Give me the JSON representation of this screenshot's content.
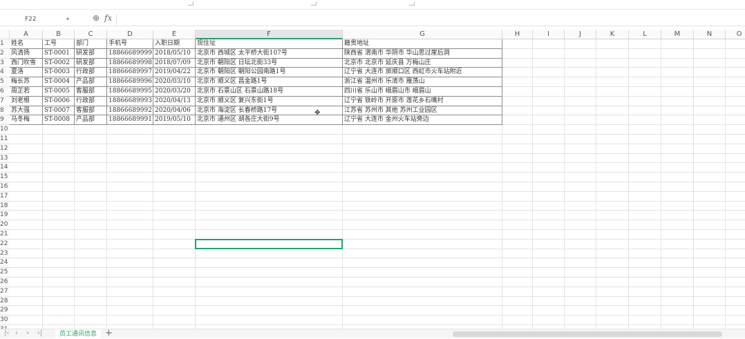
{
  "formula_bar": {
    "name_box": "F22",
    "formula": ""
  },
  "columns": [
    "A",
    "B",
    "C",
    "D",
    "E",
    "F",
    "G",
    "H",
    "I",
    "J",
    "K",
    "L",
    "M",
    "N",
    "O"
  ],
  "selected_column": "F",
  "selected_cell": "F22",
  "table": {
    "headers": [
      "姓名",
      "工号",
      "部门",
      "手机号",
      "入职日期",
      "现住址",
      "籍贯地址"
    ],
    "rows": [
      [
        "风清扬",
        "ST-0001",
        "研发部",
        "18866689999",
        "2018/05/10",
        "北京市  西城区  太平桥大街107号",
        "陕西省  渭南市  华阴市  华山思过崖后洞"
      ],
      [
        "西门吹雪",
        "ST-0002",
        "研发部",
        "18866689998",
        "2018/07/09",
        "北京市  朝阳区  日坛北街33号",
        "北京市  北京市  延庆县  万梅山庄"
      ],
      [
        "夏洛",
        "ST-0003",
        "行政部",
        "18866689997",
        "2019/04/22",
        "北京市  朝阳区  朝阳公园南路1号",
        "辽宁省  大连市  旅顺口区  西虹市火车站附近"
      ],
      [
        "梅长苏",
        "ST-0004",
        "产品部",
        "18866689996",
        "2020/03/10",
        "北京市  顺义区  昌金路1号",
        "浙江省  温州市  乐清市  雁荡山"
      ],
      [
        "周芷若",
        "ST-0005",
        "客服部",
        "18866689995",
        "2020/03/20",
        "北京市  石景山区  石景山路18号",
        "四川省  乐山市  峨眉山市  峨眉山"
      ],
      [
        "刘老根",
        "ST-0006",
        "行政部",
        "18866689993",
        "2020/04/13",
        "北京市  顺义区  复兴东街1号",
        "辽宁省  铁岭市  开原市  莲花乡石嘴村"
      ],
      [
        "苏大强",
        "ST-0007",
        "客服部",
        "18866689992",
        "2020/04/06",
        "北京市  海淀区  长春桥路17号",
        "江苏省  苏州市  其他  苏州工业园区"
      ],
      [
        "马冬梅",
        "ST-0008",
        "产品部",
        "18866689991",
        "2019/05/10",
        "北京市  通州区  胡各庄大街9号",
        "辽宁省  大连市  金州火车站旁边"
      ]
    ]
  },
  "row_count": 31,
  "sheet_tabs": [
    {
      "label": "员工通讯信息",
      "active": true
    }
  ],
  "accent_color": "#21a366"
}
